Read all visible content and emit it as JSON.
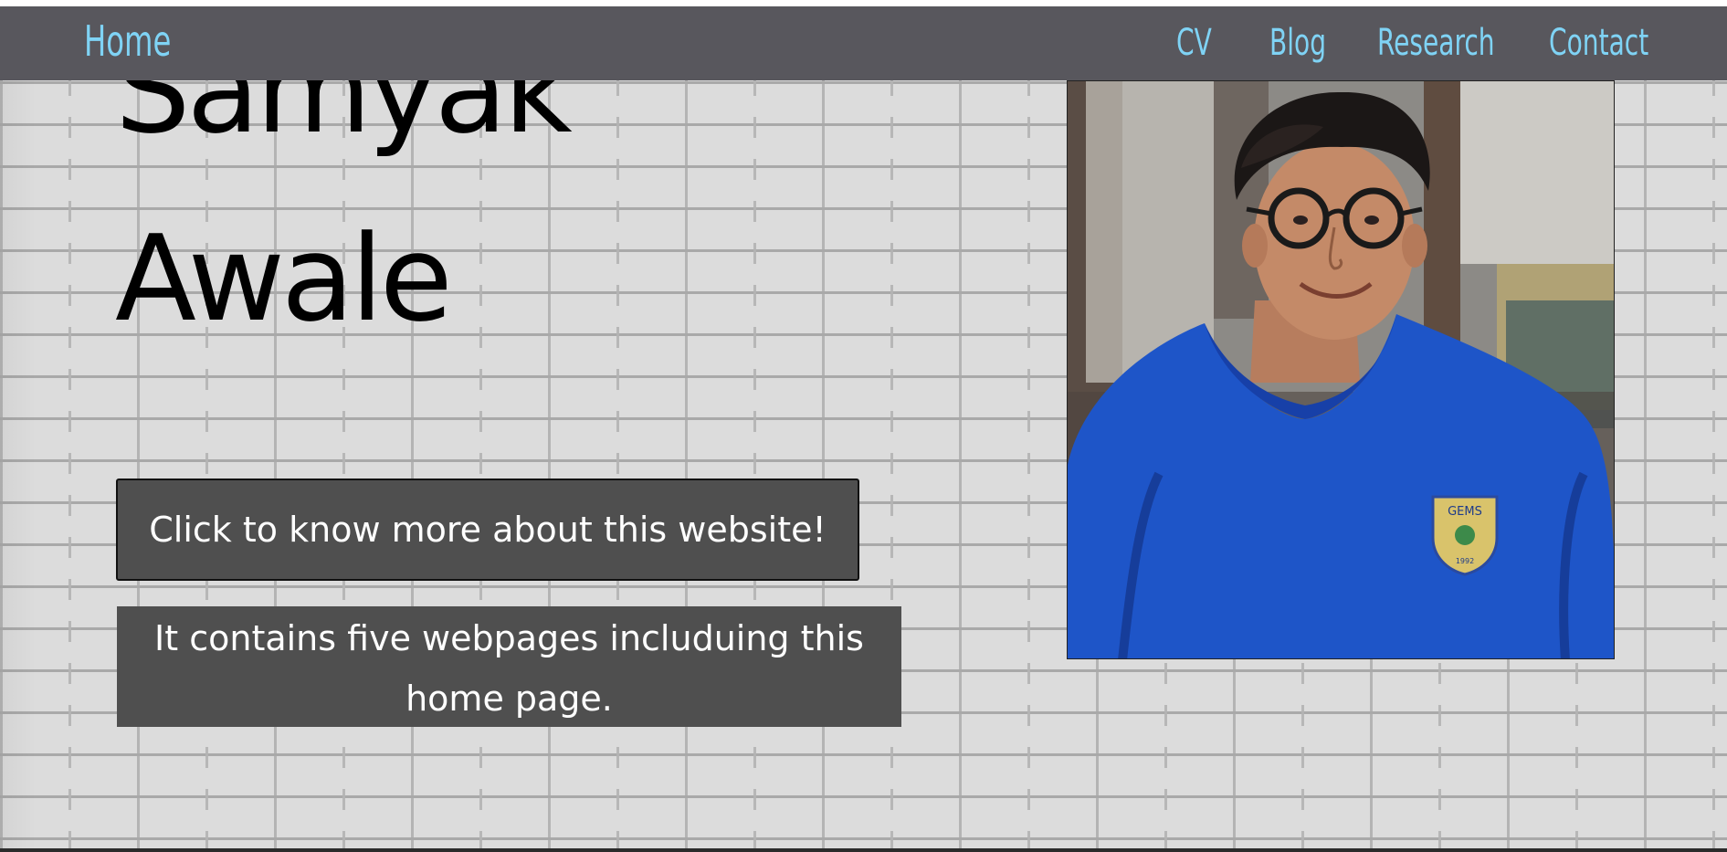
{
  "nav": {
    "home": "Home",
    "cv": "CV",
    "blog": "Blog",
    "research": "Research",
    "contact": "Contact"
  },
  "hero": {
    "first_name": "Samyak",
    "last_name": "Awale"
  },
  "about_button": {
    "label": "Click to know more about this website!"
  },
  "info_box": {
    "text": "It contains five webpages includuing this home page."
  },
  "photo": {
    "badge_text": "GEMS",
    "badge_subtext": "1992"
  },
  "colors": {
    "nav_background": "#58575d",
    "nav_link": "#7fd3f5",
    "box_background": "#4f4f4f",
    "hoodie_blue": "#1e55c8"
  }
}
